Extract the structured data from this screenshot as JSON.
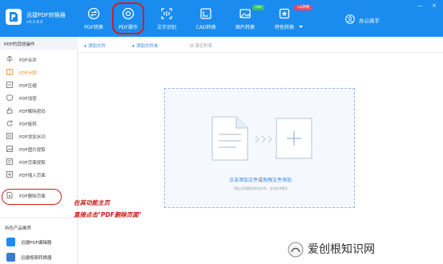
{
  "app": {
    "name": "迅捷PDF转换器",
    "version": "v9.0.8.0"
  },
  "nav": [
    {
      "label": "PDF转换",
      "icon": "convert-icon"
    },
    {
      "label": "PDF操作",
      "icon": "pdf-ops-icon"
    },
    {
      "label": "文字识别",
      "icon": "ocr-icon"
    },
    {
      "label": "CAD转换",
      "icon": "cad-icon"
    },
    {
      "label": "图片转换",
      "icon": "image-icon"
    },
    {
      "label": "特色转换",
      "icon": "feature-icon"
    }
  ],
  "badges": {
    "image": "hot",
    "feature": "caj转换"
  },
  "user": {
    "name": "办公高手"
  },
  "window": {
    "minimize": "—",
    "close": "×"
  },
  "sidebar": {
    "header": "PDF的其他操作",
    "items": [
      {
        "label": "PDF合并",
        "icon": "merge-icon"
      },
      {
        "label": "PDF分割",
        "icon": "split-icon"
      },
      {
        "label": "PDF压缩",
        "icon": "compress-icon"
      },
      {
        "label": "PDF加密",
        "icon": "lock-icon"
      },
      {
        "label": "PDF解除密码",
        "icon": "unlock-icon"
      },
      {
        "label": "PDF旋转",
        "icon": "rotate-icon"
      },
      {
        "label": "PDF添加水印",
        "icon": "watermark-icon"
      },
      {
        "label": "PDF图片提取",
        "icon": "image-extract-icon"
      },
      {
        "label": "PDF页面提取",
        "icon": "page-extract-icon"
      },
      {
        "label": "PDF插入页面",
        "icon": "insert-page-icon"
      },
      {
        "label": "PDF删除页面",
        "icon": "delete-page-icon"
      }
    ],
    "active_item": "PDF分割",
    "recommend_header": "特色产品推荐",
    "recommend": [
      {
        "label": "迅捷PDF编辑器",
        "color": "#1a8cf0"
      },
      {
        "label": "迅捷视频转换器",
        "color": "#3a7bd5"
      }
    ]
  },
  "toolbar": {
    "add_file": "添加文件",
    "add_folder": "添加文件夹",
    "clear_list": "清空列表"
  },
  "dropzone": {
    "click_add": "点击添加文件",
    "or": "或",
    "drag_add": "拖拽文件添加",
    "hint": "*通过添加按钮添加文件，支持pdf格式"
  },
  "annotations": {
    "line1": "在其功能主页",
    "line2": "直接点击\"PDF删除页面\""
  },
  "watermark": {
    "text": "爱创根知识网"
  },
  "colors": {
    "brand": "#1a8cf0",
    "highlight": "#d91b1b",
    "active": "#f08a24",
    "link": "#2b7fe0"
  }
}
